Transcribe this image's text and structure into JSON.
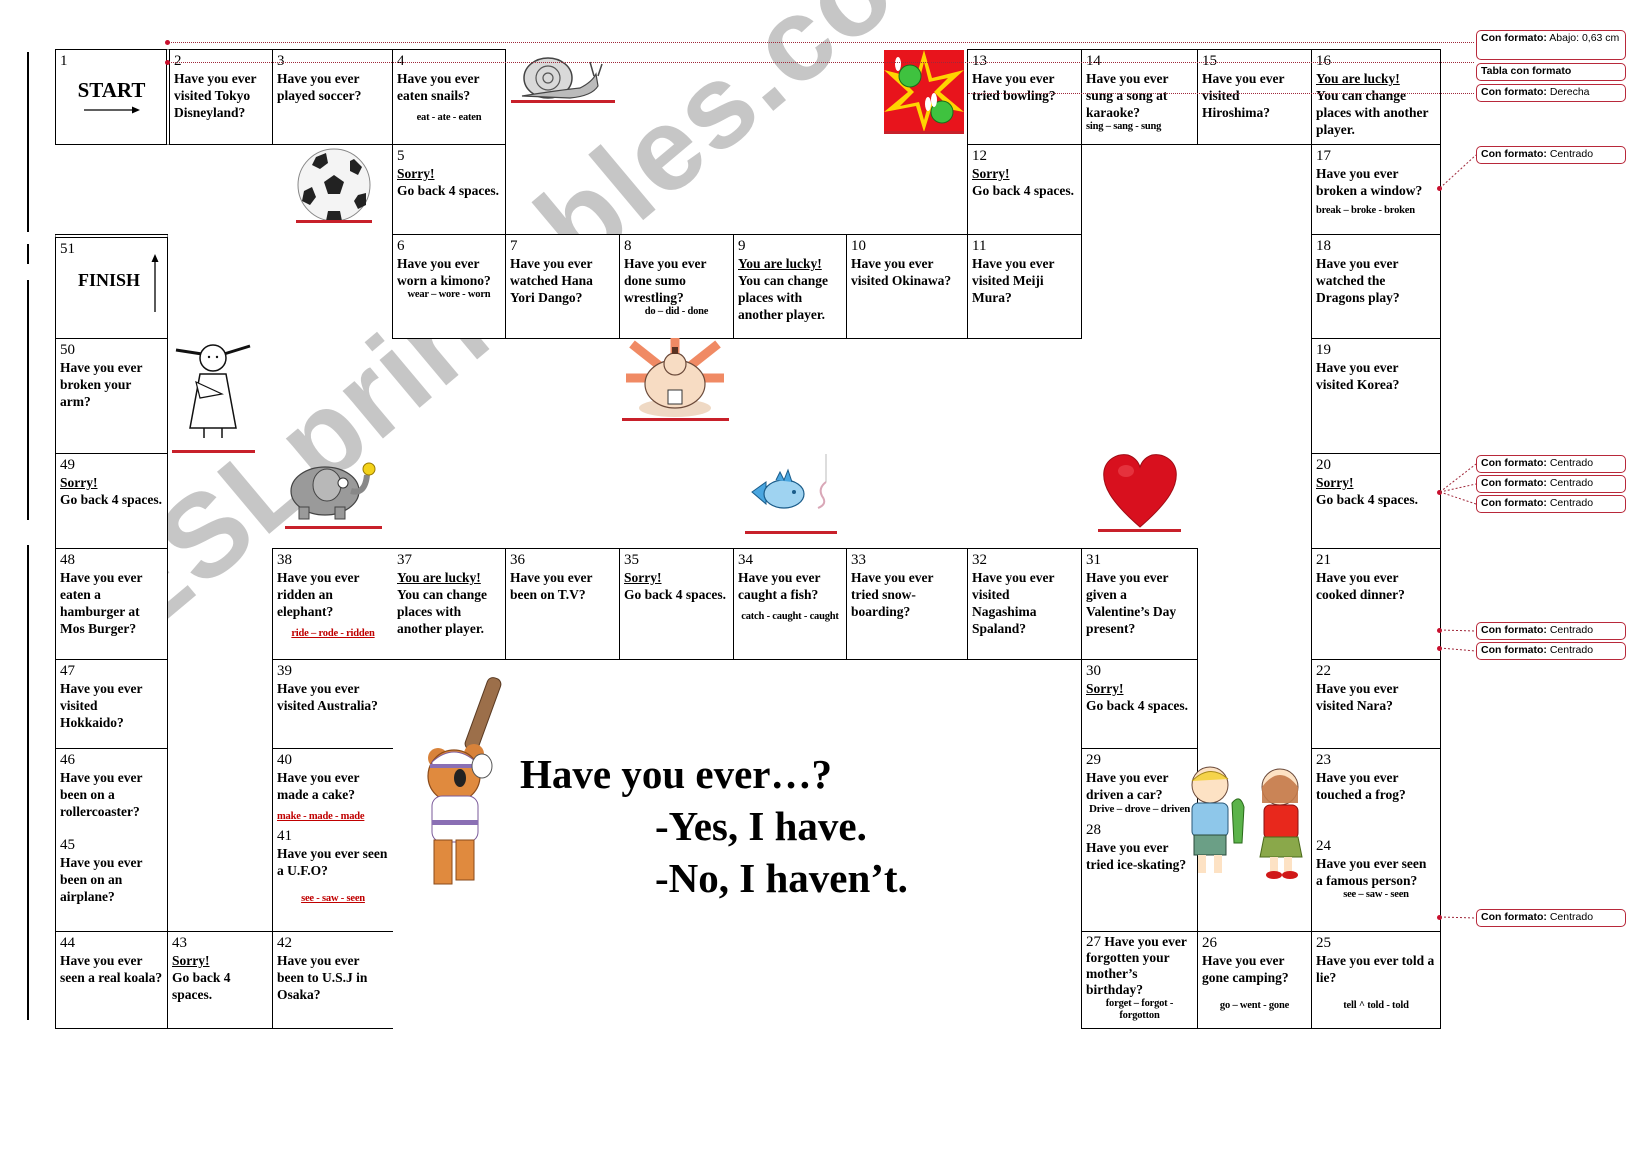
{
  "board": {
    "start": {
      "num": "1",
      "label": "START"
    },
    "finish": {
      "num": "51",
      "label": "FINISH"
    },
    "squares": {
      "s2": {
        "num": "2",
        "q": "Have you ever visited Tokyo Disneyland?"
      },
      "s3": {
        "num": "3",
        "q": "Have you ever played soccer?"
      },
      "s4": {
        "num": "4",
        "q": "Have you ever eaten snails?",
        "verb": "eat - ate - eaten"
      },
      "s5": {
        "num": "5",
        "head": "Sorry!",
        "q": "Go back 4 spaces."
      },
      "s6": {
        "num": "6",
        "q": "Have you ever worn a kimono?",
        "verb": "wear – wore - worn"
      },
      "s7": {
        "num": "7",
        "q": "Have you ever watched Hana Yori Dango?"
      },
      "s8": {
        "num": "8",
        "q": "Have you ever done sumo wrestling?",
        "verb": "do – did - done"
      },
      "s9": {
        "num": "9",
        "head": "You are lucky!",
        "q": "You can change places with another player."
      },
      "s10": {
        "num": "10",
        "q": "Have you ever visited Okinawa?"
      },
      "s11": {
        "num": "11",
        "q": "Have you ever visited Meiji Mura?"
      },
      "s12": {
        "num": "12",
        "head": "Sorry!",
        "q": "Go back 4 spaces."
      },
      "s13": {
        "num": "13",
        "q": "Have you ever tried bowling?"
      },
      "s14": {
        "num": "14",
        "q": "Have you ever sung a song at karaoke?",
        "verb": "sing – sang - sung"
      },
      "s15": {
        "num": "15",
        "q": "Have you ever visited Hiroshima?"
      },
      "s16": {
        "num": "16",
        "head": "You are lucky!",
        "q": "You can change places with another player."
      },
      "s17": {
        "num": "17",
        "q": "Have you ever broken a window?",
        "verb": "break – broke - broken"
      },
      "s18": {
        "num": "18",
        "q": "Have you ever watched the Dragons play?"
      },
      "s19": {
        "num": "19",
        "q": "Have you ever visited Korea?"
      },
      "s20": {
        "num": "20",
        "head": "Sorry!",
        "q": "Go back 4 spaces."
      },
      "s21": {
        "num": "21",
        "q": "Have you ever cooked dinner?"
      },
      "s22": {
        "num": "22",
        "q": "Have you ever visited Nara?"
      },
      "s23": {
        "num": "23",
        "q": "Have you ever touched a frog?"
      },
      "s24": {
        "num": "24",
        "q": "Have you ever seen a famous person?",
        "verb": "see – saw - seen"
      },
      "s25": {
        "num": "25",
        "q": "Have you ever told a lie?",
        "verb": "tell ^ told - told"
      },
      "s26": {
        "num": "26",
        "q": "Have you ever gone camping?",
        "verb": "go – went - gone"
      },
      "s27": {
        "num": "27",
        "q": "Have you ever forgotten your mother’s birthday?",
        "verb": "forget – forgot - forgotton"
      },
      "s28": {
        "num": "28",
        "q": "Have you ever tried ice-skating?"
      },
      "s29": {
        "num": "29",
        "q": "Have you ever driven a car?",
        "verb": "Drive – drove – driven"
      },
      "s30": {
        "num": "30",
        "head": "Sorry!",
        "q": "Go back 4 spaces."
      },
      "s31": {
        "num": "31",
        "q": "Have you ever given a Valentine’s Day present?"
      },
      "s32": {
        "num": "32",
        "q": "Have you ever visited Nagashima Spaland?"
      },
      "s33": {
        "num": "33",
        "q": "Have you ever tried snow-boarding?"
      },
      "s34": {
        "num": "34",
        "q": "Have you ever caught a fish?",
        "verb": "catch - caught - caught"
      },
      "s35": {
        "num": "35",
        "head": "Sorry!",
        "q": "Go back 4 spaces."
      },
      "s36": {
        "num": "36",
        "q": "Have you ever been on T.V?"
      },
      "s37": {
        "num": "37",
        "head": "You are lucky!",
        "q": "You can change places with another player."
      },
      "s38": {
        "num": "38",
        "q": "Have you ever ridden an elephant?",
        "verb": "ride – rode - ridden"
      },
      "s39": {
        "num": "39",
        "q": "Have you ever visited Australia?"
      },
      "s40": {
        "num": "40",
        "q": "Have you ever made a cake?",
        "verb": "make - made - made"
      },
      "s41": {
        "num": "41",
        "q": "Have you ever seen a U.F.O?",
        "verb": "see - saw - seen"
      },
      "s42": {
        "num": "42",
        "q": "Have you ever been to U.S.J in Osaka?"
      },
      "s43": {
        "num": "43",
        "head": "Sorry!",
        "q": "Go back 4 spaces."
      },
      "s44": {
        "num": "44",
        "q": "Have you ever seen a real koala?"
      },
      "s45": {
        "num": "45",
        "q": "Have you ever been on an airplane?"
      },
      "s46": {
        "num": "46",
        "q": "Have you ever been on a rollercoaster?"
      },
      "s47": {
        "num": "47",
        "q": "Have you ever visited Hokkaido?"
      },
      "s48": {
        "num": "48",
        "q": "Have you ever eaten a hamburger at Mos Burger?"
      },
      "s49": {
        "num": "49",
        "head": "Sorry!",
        "q": "Go back 4 spaces."
      },
      "s50": {
        "num": "50",
        "q": "Have you ever broken your arm?"
      }
    }
  },
  "center_title": {
    "line1": "Have you ever…?",
    "line2": "-Yes, I have.",
    "line3": "-No, I haven’t."
  },
  "watermark": "ESLprintables.com",
  "comments": [
    {
      "bold": "Con formato:",
      "text": " Abajo:  0,63 cm"
    },
    {
      "bold": "Tabla con formato",
      "text": ""
    },
    {
      "bold": "Con formato:",
      "text": " Derecha"
    },
    {
      "bold": "Con formato:",
      "text": " Centrado"
    },
    {
      "bold": "Con formato:",
      "text": " Centrado"
    },
    {
      "bold": "Con formato:",
      "text": " Centrado"
    },
    {
      "bold": "Con formato:",
      "text": " Centrado"
    },
    {
      "bold": "Con formato:",
      "text": " Centrado"
    },
    {
      "bold": "Con formato:",
      "text": " Centrado"
    },
    {
      "bold": "Con formato:",
      "text": " Centrado"
    }
  ],
  "colors": {
    "accent_red": "#c8202a",
    "comment_border": "#b8283a",
    "verb_red": "#c00000"
  }
}
